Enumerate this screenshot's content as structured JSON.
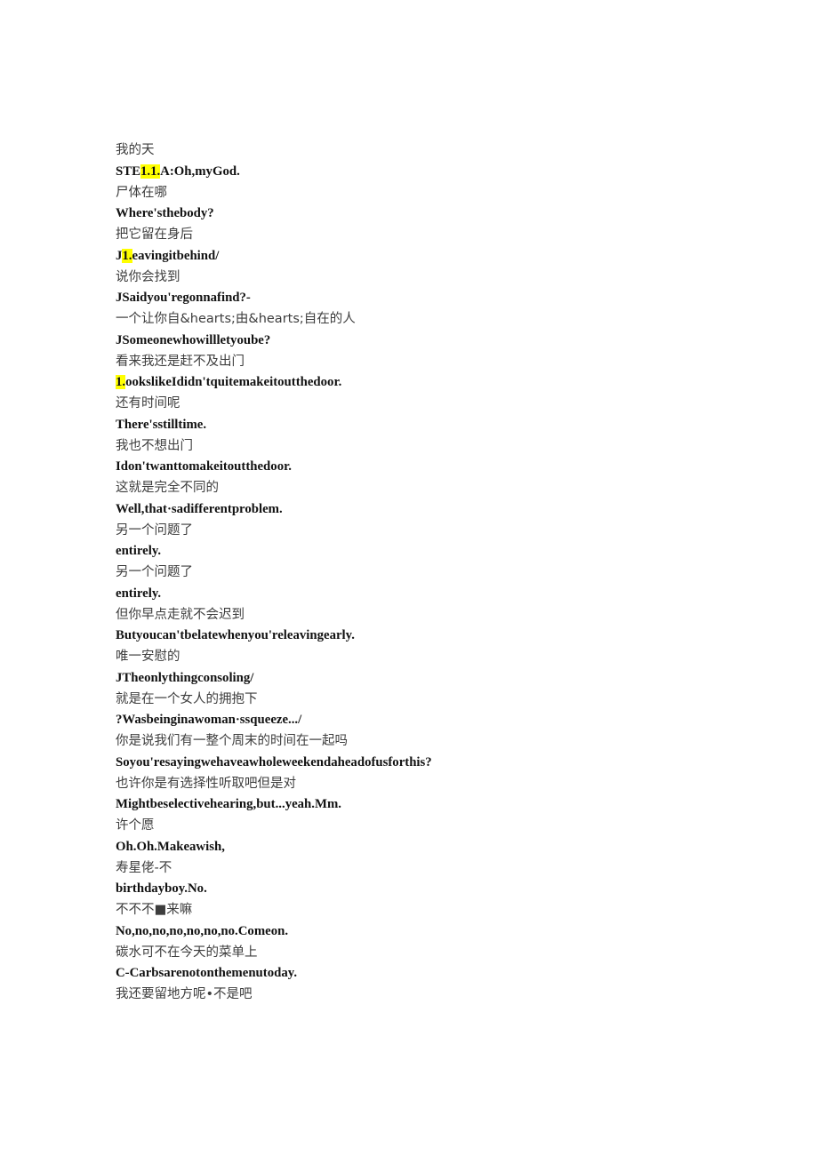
{
  "document": {
    "kind": "bilingual-subtitle-transcript",
    "background_color": "#ffffff",
    "zh_text_color": "#3d3d3d",
    "en_text_color": "#121212",
    "highlight_color": "#ffff00"
  },
  "lines": [
    {
      "id": "line-1",
      "lang": "zh",
      "text": "我的天"
    },
    {
      "id": "line-2",
      "lang": "en",
      "runs": [
        {
          "text": "STE",
          "highlight": false
        },
        {
          "text": "1.1.",
          "highlight": true
        },
        {
          "text": "A:Oh,myGod.",
          "highlight": false
        }
      ]
    },
    {
      "id": "line-3",
      "lang": "zh",
      "text": "尸体在哪"
    },
    {
      "id": "line-4",
      "lang": "en",
      "text": "Where'sthebody?"
    },
    {
      "id": "line-5",
      "lang": "zh",
      "text": "把它留在身后"
    },
    {
      "id": "line-6",
      "lang": "en",
      "runs": [
        {
          "text": "J",
          "highlight": false
        },
        {
          "text": "1.",
          "highlight": true
        },
        {
          "text": "eavingitbehind/",
          "highlight": false
        }
      ]
    },
    {
      "id": "line-7",
      "lang": "zh",
      "text": "说你会找到"
    },
    {
      "id": "line-8",
      "lang": "en",
      "text": "JSaidyou'regonnafind?-"
    },
    {
      "id": "line-9",
      "lang": "zh",
      "text": "一个让你自&hearts;由&hearts;自在的人"
    },
    {
      "id": "line-10",
      "lang": "en",
      "text": "JSomeonewhowillletyoube?"
    },
    {
      "id": "line-11",
      "lang": "zh",
      "text": "看来我还是赶不及出门"
    },
    {
      "id": "line-12",
      "lang": "en",
      "runs": [
        {
          "text": "1.",
          "highlight": true
        },
        {
          "text": "ookslikeIdidn'tquitemakeitoutthedoor.",
          "highlight": false
        }
      ]
    },
    {
      "id": "line-13",
      "lang": "zh",
      "text": "还有时间呢"
    },
    {
      "id": "line-14",
      "lang": "en",
      "text": "There'sstilltime."
    },
    {
      "id": "line-15",
      "lang": "zh",
      "text": "我也不想出门"
    },
    {
      "id": "line-16",
      "lang": "en",
      "text": "Idon'twanttomakeitoutthedoor."
    },
    {
      "id": "line-17",
      "lang": "zh",
      "text": "这就是完全不同的"
    },
    {
      "id": "line-18",
      "lang": "en",
      "text": "Well,that·sadifferentproblem."
    },
    {
      "id": "line-19",
      "lang": "zh",
      "text": "另一个问题了"
    },
    {
      "id": "line-20",
      "lang": "en",
      "text": "entirely."
    },
    {
      "id": "line-21",
      "lang": "zh",
      "text": "另一个问题了"
    },
    {
      "id": "line-22",
      "lang": "en",
      "text": "entirely."
    },
    {
      "id": "line-23",
      "lang": "zh",
      "text": "但你早点走就不会迟到"
    },
    {
      "id": "line-24",
      "lang": "en",
      "text": "Butyoucan'tbelatewhenyou'releavingearly."
    },
    {
      "id": "line-25",
      "lang": "zh",
      "text": "唯一安慰的"
    },
    {
      "id": "line-26",
      "lang": "en",
      "text": "JTheonlythingconsoling/"
    },
    {
      "id": "line-27",
      "lang": "zh",
      "text": "就是在一个女人的拥抱下"
    },
    {
      "id": "line-28",
      "lang": "en",
      "text": "?Wasbeinginawoman·ssqueeze.../"
    },
    {
      "id": "line-29",
      "lang": "zh",
      "text": "你是说我们有一整个周末的时间在一起吗"
    },
    {
      "id": "line-30",
      "lang": "en",
      "text": "Soyou'resayingwehaveawholeweekendaheadofusforthis?"
    },
    {
      "id": "line-31",
      "lang": "zh",
      "text": "也许你是有选择性听取吧但是对"
    },
    {
      "id": "line-32",
      "lang": "en",
      "text": "Mightbeselectivehearing,but...yeah.Mm."
    },
    {
      "id": "line-33",
      "lang": "zh",
      "text": "许个愿"
    },
    {
      "id": "line-34",
      "lang": "en",
      "text": "Oh.Oh.Makeawish,"
    },
    {
      "id": "line-35",
      "lang": "zh",
      "text": "寿星佬-不"
    },
    {
      "id": "line-36",
      "lang": "en",
      "text": "birthdayboy.No."
    },
    {
      "id": "line-37",
      "lang": "zh",
      "text": "不不不■来嘛"
    },
    {
      "id": "line-38",
      "lang": "en",
      "text": "No,no,no,no,no,no,no.Comeon."
    },
    {
      "id": "line-39",
      "lang": "zh",
      "text": "碳水可不在今天的菜单上"
    },
    {
      "id": "line-40",
      "lang": "en",
      "text": "C-Carbsarenotonthemenutoday."
    },
    {
      "id": "line-41",
      "lang": "zh",
      "text": "我还要留地方呢•不是吧"
    }
  ]
}
